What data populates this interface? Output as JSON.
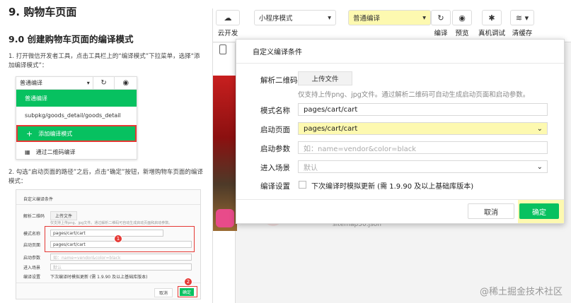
{
  "doc": {
    "section_title": "9. 购物车页面",
    "subsection_title": "9.0 创建购物车页面的编译模式",
    "step1": "1. 打开微信开发者工具，点击工具栏上的“编译模式”下拉菜单，选择“添加编译模式”：",
    "step2": "2. 勾选“启动页面的路径”之后，点击“确定”按钮，新增购物车页面的编译模式：",
    "dropdown": {
      "selected": "普通编译",
      "items": [
        "普通编译",
        "subpkg/goods_detail/goods_detail",
        "添加编译模式",
        "通过二维码编译"
      ]
    },
    "mini_dialog": {
      "title": "自定义编译条件",
      "labels": [
        "解析二维码",
        "模式名称",
        "启动页面",
        "启动参数",
        "进入场景",
        "编译设置"
      ],
      "upload": "上传文件",
      "note": "仅支持上传png、jpg文件。通过解析二维码可自动生成启动页面和启动参数。",
      "mode_name": "pages/cart/cart",
      "start_page": "pages/cart/cart",
      "param_placeholder": "如：name=vendor&color=black",
      "scene": "默认",
      "compile_setting": "下次编译时模拟更新 (需 1.9.90 及以上基础库版本)",
      "cancel": "取消",
      "confirm": "确定",
      "badges": [
        "1",
        "2"
      ]
    }
  },
  "toolbar": {
    "cloud_label": "云开发",
    "mode_select": "小程序模式",
    "compile_select": "普通编译",
    "compile_label": "编译",
    "preview_label": "预览",
    "debug_label": "真机调试",
    "clear_label": "清缓存"
  },
  "dialog": {
    "title": "自定义编译条件",
    "qr_label": "解析二维码",
    "upload_button": "上传文件",
    "upload_note": "仅支持上传png、jpg文件。通过解析二维码可自动生成启动页面和启动参数。",
    "mode_name_label": "模式名称",
    "mode_name_value": "pages/cart/cart",
    "start_page_label": "启动页面",
    "start_page_value": "pages/cart/cart",
    "start_param_label": "启动参数",
    "start_param_placeholder": "如：name=vendor&color=black",
    "scene_label": "进入场景",
    "scene_value": "默认",
    "compile_setting_label": "编译设置",
    "compile_setting_text": "下次编译时模拟更新 (需 1.9.90 及以上基础库版本)",
    "cancel": "取消",
    "confirm": "确定"
  },
  "background_text": "sitemap50.json",
  "watermark": "@稀土掘金技术社区",
  "colors": {
    "green": "#07c160",
    "highlight": "#fdf9b0",
    "red": "#e53935"
  }
}
